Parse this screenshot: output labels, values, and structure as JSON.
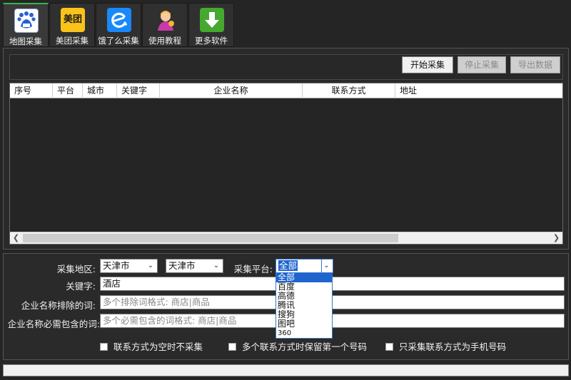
{
  "toolbar": {
    "buttons": [
      {
        "label": "地图采集",
        "icon": "baidu-map-icon"
      },
      {
        "label": "美团采集",
        "icon": "meituan-icon",
        "icon_text": "美团"
      },
      {
        "label": "饿了么采集",
        "icon": "eleme-icon"
      },
      {
        "label": "使用教程",
        "icon": "tutorial-icon"
      },
      {
        "label": "更多软件",
        "icon": "download-icon"
      }
    ]
  },
  "actions": {
    "start": "开始采集",
    "stop": "停止采集",
    "export": "导出数据"
  },
  "table": {
    "columns": [
      "序号",
      "平台",
      "城市",
      "关键字",
      "企业名称",
      "联系方式",
      "地址"
    ],
    "rows": []
  },
  "form": {
    "region_label": "采集地区:",
    "province": "天津市",
    "city": "天津市",
    "platform_label": "采集平台:",
    "platform_value": "全部",
    "keyword_label": "关键字:",
    "keyword_value": "酒店",
    "exclude_label": "企业名称排除的词:",
    "exclude_placeholder": "多个排除词格式: 商店|商品",
    "include_label": "企业名称必需包含的词:",
    "include_placeholder": "多个必需包含的词格式: 商店|商品",
    "checkboxes": [
      {
        "label": "联系方式为空时不采集",
        "checked": false
      },
      {
        "label": "多个联系方式时保留第一个号码",
        "checked": false
      },
      {
        "label": "只采集联系方式为手机号码",
        "checked": false
      }
    ]
  },
  "platform_dropdown": {
    "options": [
      "全部",
      "百度",
      "高德",
      "腾讯",
      "搜狗",
      "图吧",
      "360"
    ],
    "selected": "全部"
  },
  "colors": {
    "background": "#252525",
    "active_tab_accent": "#38b648",
    "dropdown_highlight": "#1e64cf"
  }
}
